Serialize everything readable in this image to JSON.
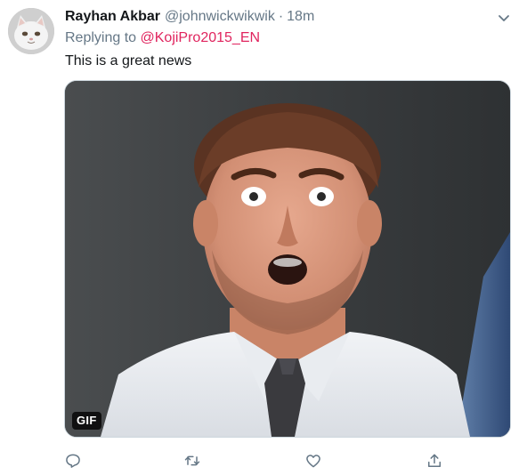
{
  "tweet": {
    "display_name": "Rayhan Akbar",
    "handle": "@johnwickwikwik",
    "separator": "·",
    "time": "18m",
    "reply_prefix": "Replying to",
    "reply_to": "@KojiPro2015_EN",
    "text": "This is a great news",
    "media_badge": "GIF"
  },
  "icons": {
    "avatar": "cat-avatar",
    "more": "chevron-down-icon",
    "reply": "comment-icon",
    "retweet": "retweet-icon",
    "like": "heart-icon",
    "share": "share-icon"
  },
  "colors": {
    "name": "#14171a",
    "meta": "#657786",
    "mention": "#e0245e",
    "border": "#ccd6dd"
  }
}
